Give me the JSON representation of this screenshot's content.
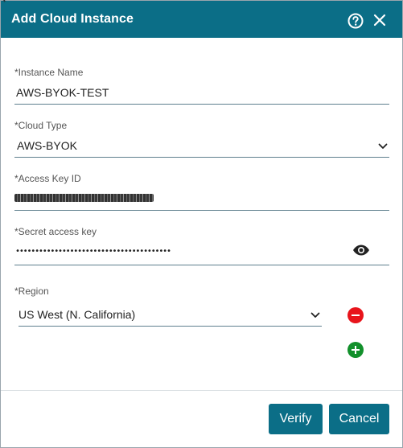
{
  "dialog": {
    "title": "Add Cloud Instance",
    "corner_mark": "*",
    "accent_color": "#0b6e87"
  },
  "icons": {
    "help": "help-circle-icon",
    "close": "close-icon",
    "visibility": "eye-icon",
    "remove": "minus-circle-icon",
    "add": "plus-circle-icon"
  },
  "form": {
    "instance_name": {
      "label": "*Instance Name",
      "value": "AWS-BYOK-TEST"
    },
    "cloud_type": {
      "label": "*Cloud Type",
      "value": "AWS-BYOK"
    },
    "access_key_id": {
      "label": "*Access Key ID",
      "value_redacted": true
    },
    "secret_access_key": {
      "label": "*Secret access key",
      "masked_value": "••••••••••••••••••••••••••••••••••••••••"
    },
    "region": {
      "label": "*Region",
      "value": "US West (N. California)"
    }
  },
  "actions": {
    "verify": "Verify",
    "cancel": "Cancel"
  },
  "colors": {
    "remove": "#e8141b",
    "add": "#12902b"
  }
}
